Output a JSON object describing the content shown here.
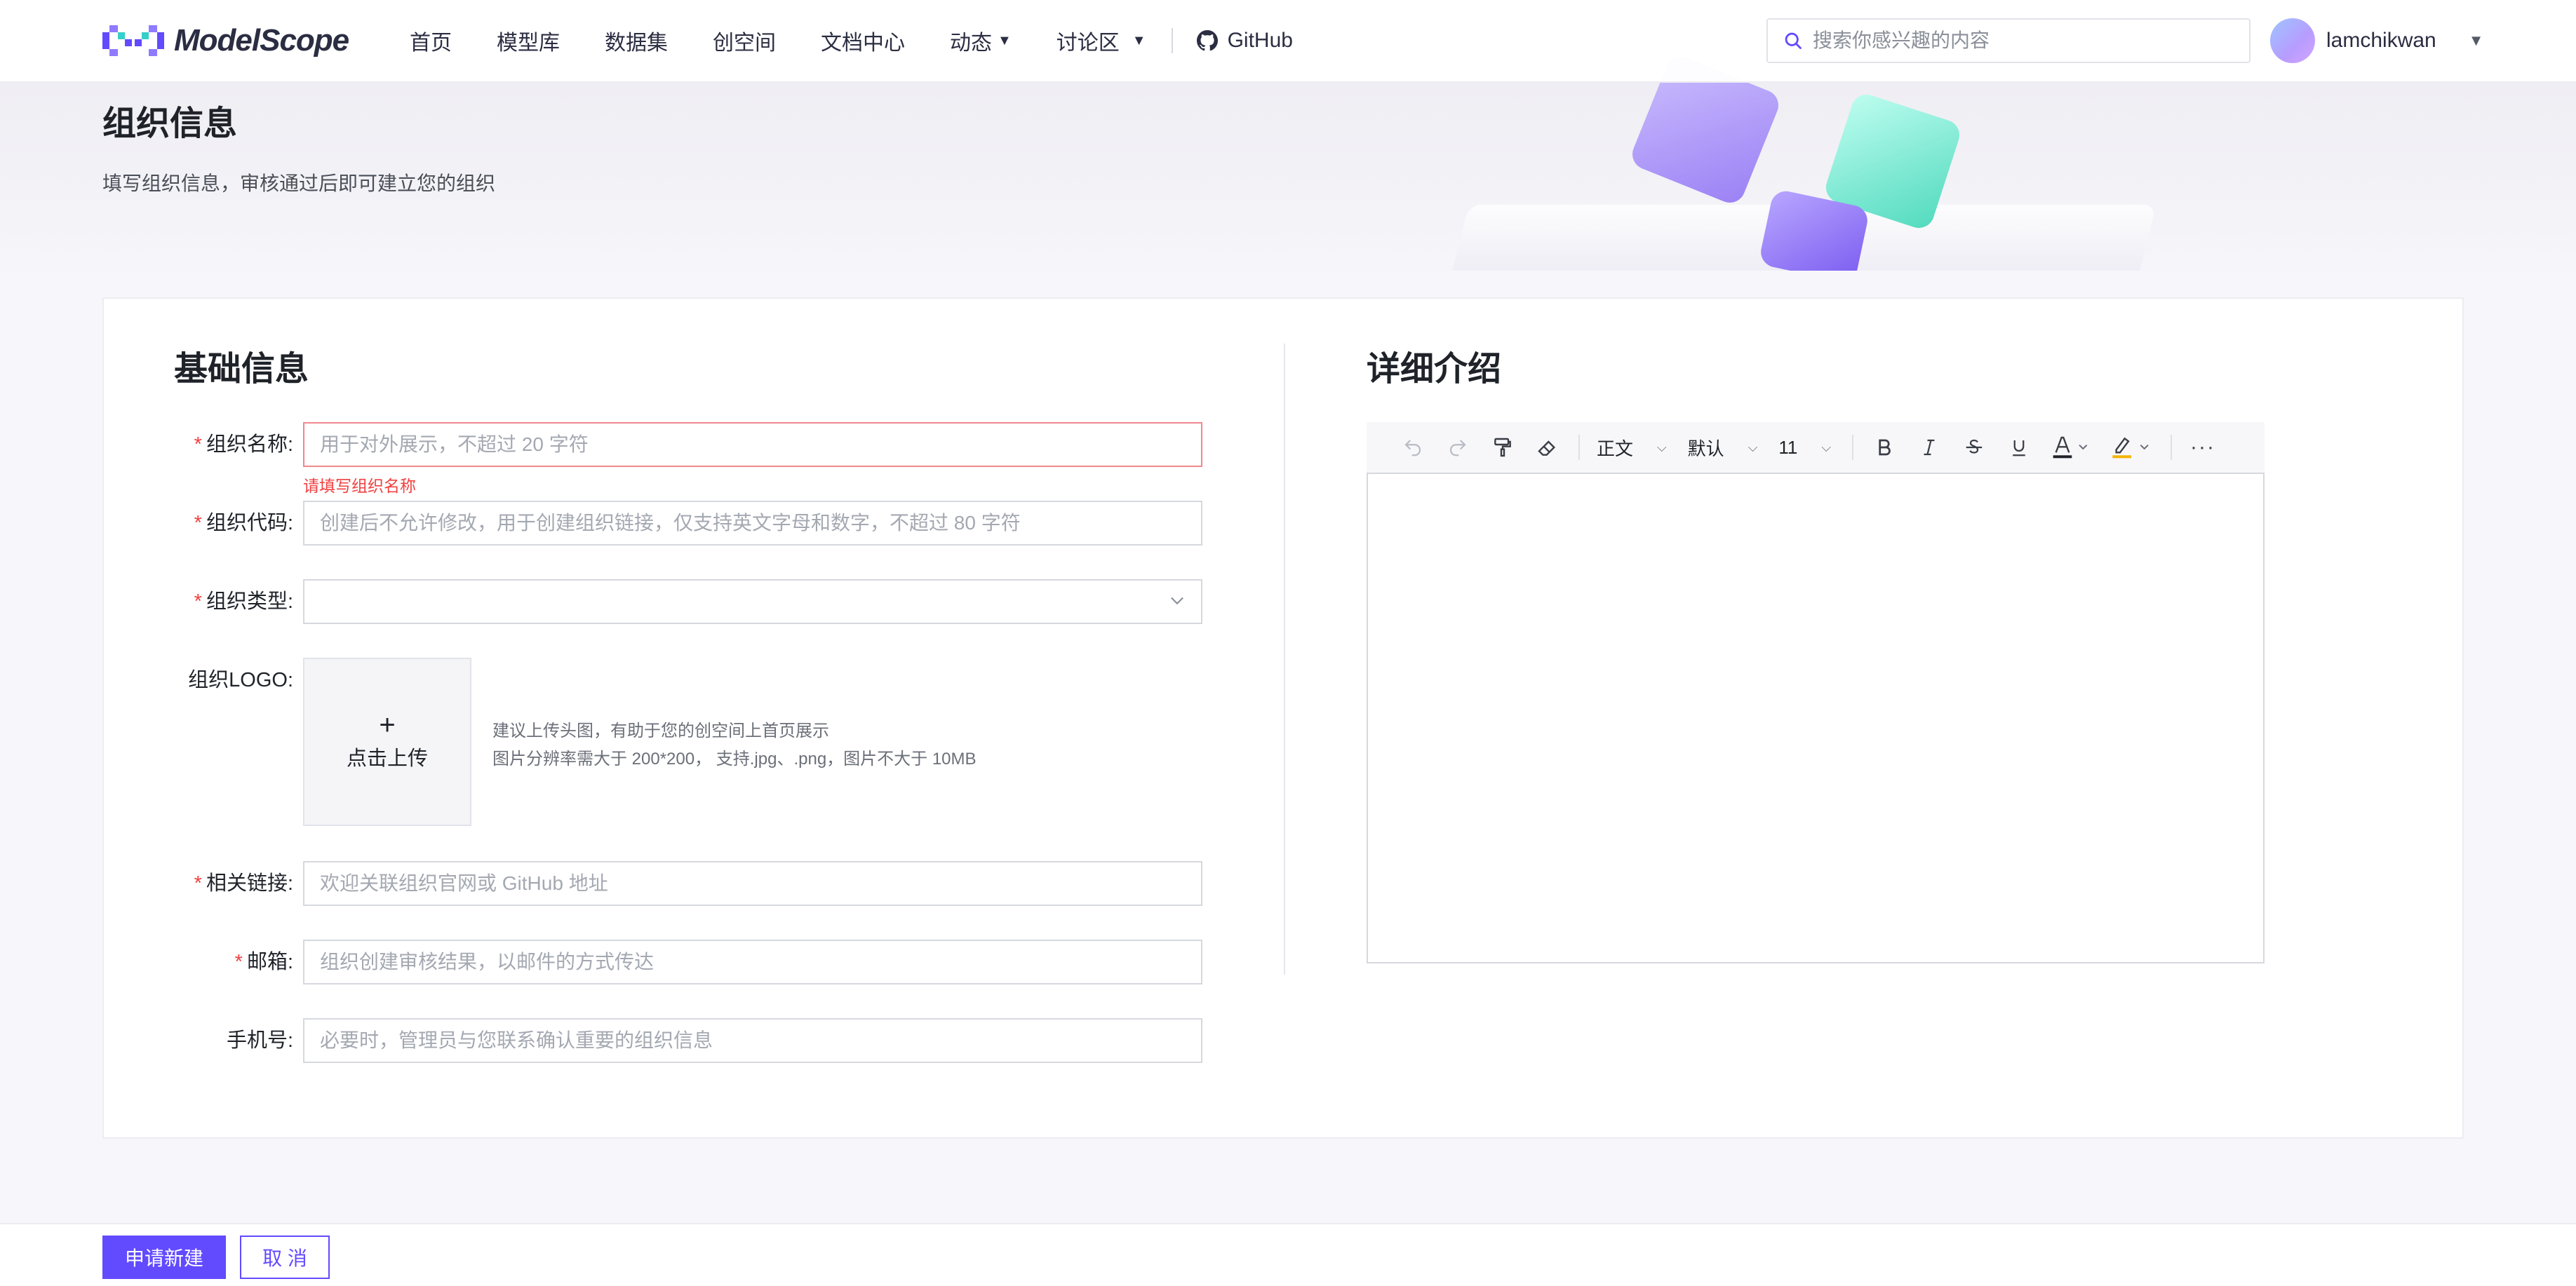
{
  "header": {
    "brand": "ModelScope",
    "nav": [
      {
        "label": "首页"
      },
      {
        "label": "模型库"
      },
      {
        "label": "数据集"
      },
      {
        "label": "创空间"
      },
      {
        "label": "文档中心"
      },
      {
        "label": "动态",
        "dropdown": true
      },
      {
        "label": "讨论区",
        "dropdown": true
      }
    ],
    "github_label": "GitHub",
    "search_placeholder": "搜索你感兴趣的内容",
    "username": "lamchikwan"
  },
  "banner": {
    "title": "组织信息",
    "subtitle": "填写组织信息，审核通过后即可建立您的组织"
  },
  "basic": {
    "title": "基础信息",
    "fields": {
      "name": {
        "label": "组织名称:",
        "required": true,
        "placeholder": "用于对外展示，不超过 20 字符",
        "error": "请填写组织名称"
      },
      "code": {
        "label": "组织代码:",
        "required": true,
        "placeholder": "创建后不允许修改，用于创建组织链接，仅支持英文字母和数字，不超过 80 字符"
      },
      "type": {
        "label": "组织类型:",
        "required": true,
        "value": ""
      },
      "logo": {
        "label": "组织LOGO:",
        "upload_label": "点击上传",
        "hint_line1": "建议上传头图，有助于您的创空间上首页展示",
        "hint_line2": "图片分辨率需大于 200*200， 支持.jpg、.png，图片不大于 10MB"
      },
      "link": {
        "label": "相关链接:",
        "required": true,
        "placeholder": "欢迎关联组织官网或 GitHub 地址"
      },
      "email": {
        "label": "邮箱:",
        "required": true,
        "placeholder": "组织创建审核结果，以邮件的方式传达"
      },
      "phone": {
        "label": "手机号:",
        "required": false,
        "placeholder": "必要时，管理员与您联系确认重要的组织信息"
      }
    },
    "required_mark": "*"
  },
  "detail": {
    "title": "详细介绍",
    "toolbar": {
      "paragraph": "正文",
      "font": "默认",
      "size": "11",
      "more": "···"
    }
  },
  "footer": {
    "submit_label": "申请新建",
    "cancel_label": "取 消"
  },
  "colors": {
    "accent": "#624aff",
    "error": "#f04142"
  }
}
